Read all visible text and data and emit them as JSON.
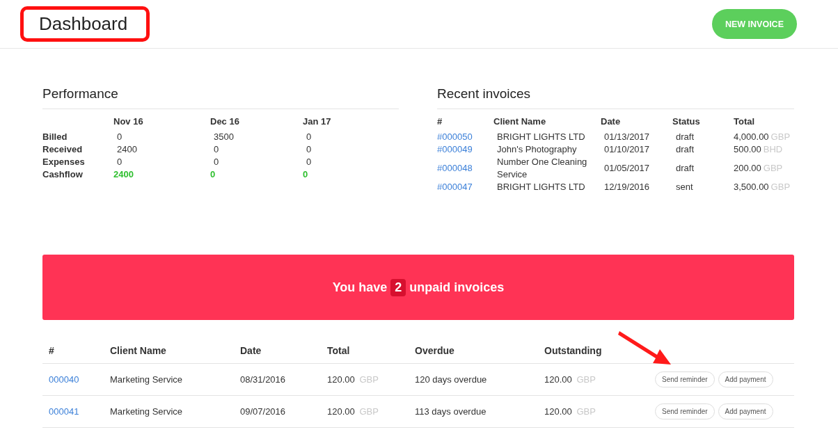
{
  "header": {
    "title": "Dashboard",
    "new_invoice_button": "NEW INVOICE"
  },
  "performance": {
    "title": "Performance",
    "columns": [
      "Nov 16",
      "Dec 16",
      "Jan 17"
    ],
    "rows": [
      {
        "label": "Billed",
        "kind": "plain",
        "values": [
          "0",
          "3500",
          "0"
        ]
      },
      {
        "label": "Received",
        "kind": "plain",
        "values": [
          "2400",
          "0",
          "0"
        ]
      },
      {
        "label": "Expenses",
        "kind": "plain",
        "values": [
          "0",
          "0",
          "0"
        ]
      },
      {
        "label": "Cashflow",
        "kind": "positive",
        "values": [
          "2400",
          "0",
          "0"
        ]
      }
    ]
  },
  "recent_invoices": {
    "title": "Recent invoices",
    "columns": [
      "#",
      "Client Name",
      "Date",
      "Status",
      "Total"
    ],
    "rows": [
      {
        "number": "#000050",
        "client": "BRIGHT LIGHTS LTD",
        "date": "01/13/2017",
        "status": "draft",
        "amount": "4,000.00",
        "currency": "GBP"
      },
      {
        "number": "#000049",
        "client": "John's Photography",
        "date": "01/10/2017",
        "status": "draft",
        "amount": "500.00",
        "currency": "BHD"
      },
      {
        "number": "#000048",
        "client": "Number One Cleaning Service",
        "date": "01/05/2017",
        "status": "draft",
        "amount": "200.00",
        "currency": "GBP"
      },
      {
        "number": "#000047",
        "client": "BRIGHT LIGHTS LTD",
        "date": "12/19/2016",
        "status": "sent",
        "amount": "3,500.00",
        "currency": "GBP"
      }
    ]
  },
  "unpaid_banner": {
    "prefix": "You have",
    "count": "2",
    "suffix": "unpaid invoices"
  },
  "unpaid_table": {
    "columns": [
      "#",
      "Client Name",
      "Date",
      "Total",
      "Overdue",
      "Outstanding"
    ],
    "rows": [
      {
        "number": "000040",
        "client": "Marketing Service",
        "date": "08/31/2016",
        "total": "120.00",
        "total_currency": "GBP",
        "overdue": "120 days overdue",
        "outstanding": "120.00",
        "outstanding_currency": "GBP",
        "actions": [
          "Send reminder",
          "Add payment"
        ]
      },
      {
        "number": "000041",
        "client": "Marketing Service",
        "date": "09/07/2016",
        "total": "120.00",
        "total_currency": "GBP",
        "overdue": "113 days overdue",
        "outstanding": "120.00",
        "outstanding_currency": "GBP",
        "actions": [
          "Send reminder",
          "Add payment"
        ]
      }
    ]
  }
}
